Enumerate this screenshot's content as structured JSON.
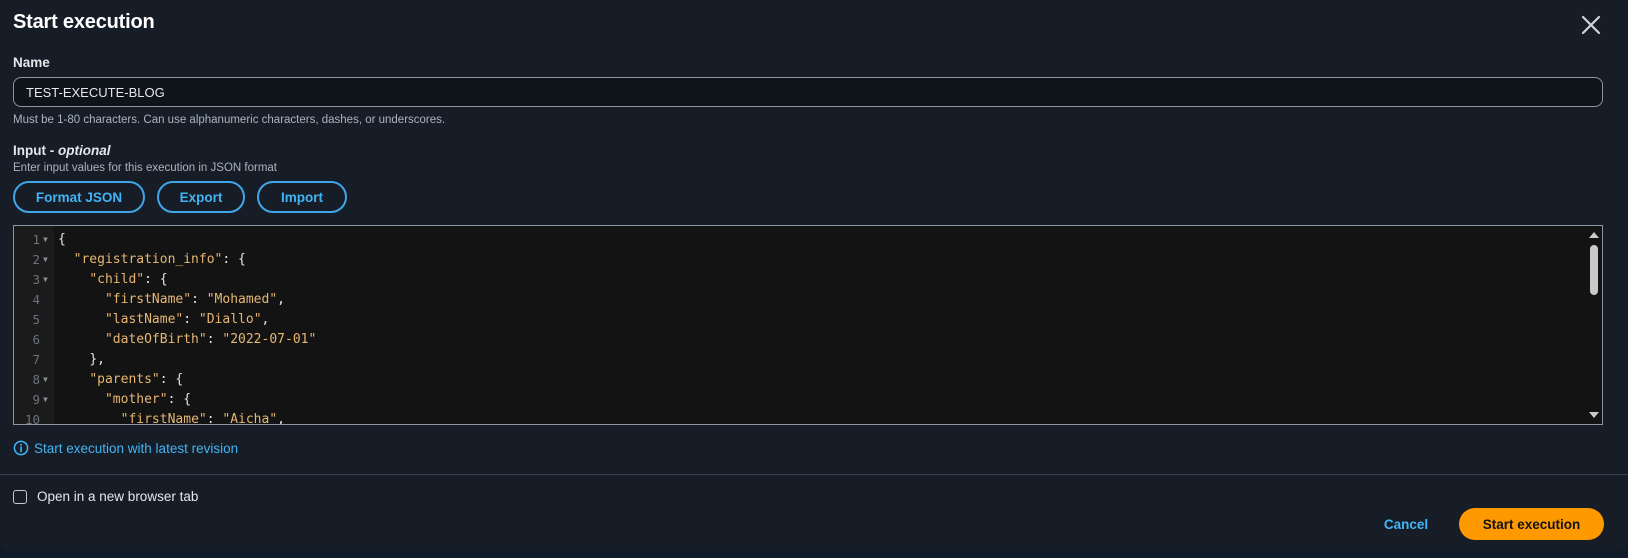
{
  "dialog": {
    "title": "Start execution",
    "close_icon": "close-icon"
  },
  "name_field": {
    "label": "Name",
    "value": "TEST-EXECUTE-BLOG",
    "hint": "Must be 1-80 characters. Can use alphanumeric characters, dashes, or underscores."
  },
  "input_field": {
    "label": "Input - ",
    "label_optional": "optional",
    "hint": "Enter input values for this execution in JSON format"
  },
  "buttons": {
    "format_json": "Format JSON",
    "export": "Export",
    "import": "Import",
    "cancel": "Cancel",
    "start_execution": "Start execution"
  },
  "editor": {
    "lines": [
      {
        "num": "1",
        "fold": true,
        "indent": "",
        "key": "",
        "rest": "{"
      },
      {
        "num": "2",
        "fold": true,
        "indent": "  ",
        "key": "\"registration_info\"",
        "rest": ": {"
      },
      {
        "num": "3",
        "fold": true,
        "indent": "    ",
        "key": "\"child\"",
        "rest": ": {"
      },
      {
        "num": "4",
        "fold": false,
        "indent": "      ",
        "key": "\"firstName\"",
        "rest": ": ",
        "str": "\"Mohamed\"",
        "tail": ","
      },
      {
        "num": "5",
        "fold": false,
        "indent": "      ",
        "key": "\"lastName\"",
        "rest": ": ",
        "str": "\"Diallo\"",
        "tail": ","
      },
      {
        "num": "6",
        "fold": false,
        "indent": "      ",
        "key": "\"dateOfBirth\"",
        "rest": ": ",
        "str": "\"2022-07-01\"",
        "tail": ""
      },
      {
        "num": "7",
        "fold": false,
        "indent": "    ",
        "key": "",
        "rest": "},"
      },
      {
        "num": "8",
        "fold": true,
        "indent": "    ",
        "key": "\"parents\"",
        "rest": ": {"
      },
      {
        "num": "9",
        "fold": true,
        "indent": "      ",
        "key": "\"mother\"",
        "rest": ": {"
      },
      {
        "num": "10",
        "fold": false,
        "indent": "        ",
        "key": "\"firstName\"",
        "rest": ": ",
        "str": "\"Aicha\"",
        "tail": ","
      }
    ]
  },
  "revision_link": {
    "text": "Start execution with latest revision",
    "icon": "info-icon"
  },
  "new_tab": {
    "label": "Open in a new browser tab",
    "checked": false
  },
  "colors": {
    "accent_link": "#42b4f5",
    "primary_button": "#ff9900",
    "json_string": "#e6b673"
  }
}
